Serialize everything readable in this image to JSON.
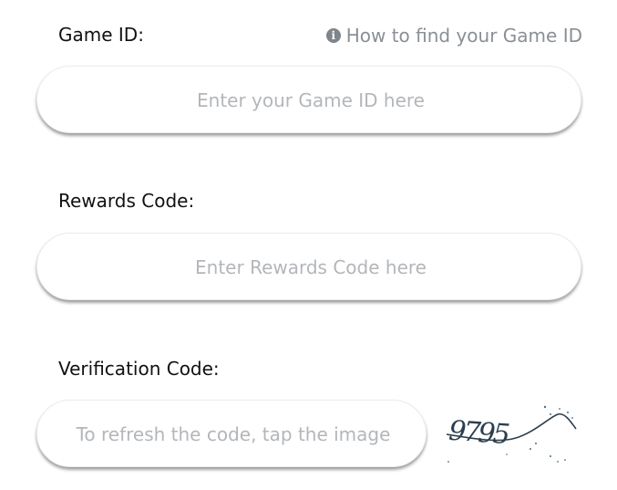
{
  "game_id": {
    "label": "Game ID:",
    "help_link": "How to find your Game ID",
    "placeholder": "Enter your Game ID here",
    "value": ""
  },
  "rewards_code": {
    "label": "Rewards Code:",
    "placeholder": "Enter Rewards Code here",
    "value": ""
  },
  "verification_code": {
    "label": "Verification Code:",
    "placeholder": "To refresh the code, tap the image",
    "value": "",
    "captcha_text": "9795"
  },
  "icons": {
    "help": "info-icon",
    "captcha": "captcha-image"
  },
  "colors": {
    "label_text": "#111111",
    "placeholder_text": "#b3b6ba",
    "help_text": "#8a8f96",
    "captcha_ink": "#2c3e4e"
  }
}
